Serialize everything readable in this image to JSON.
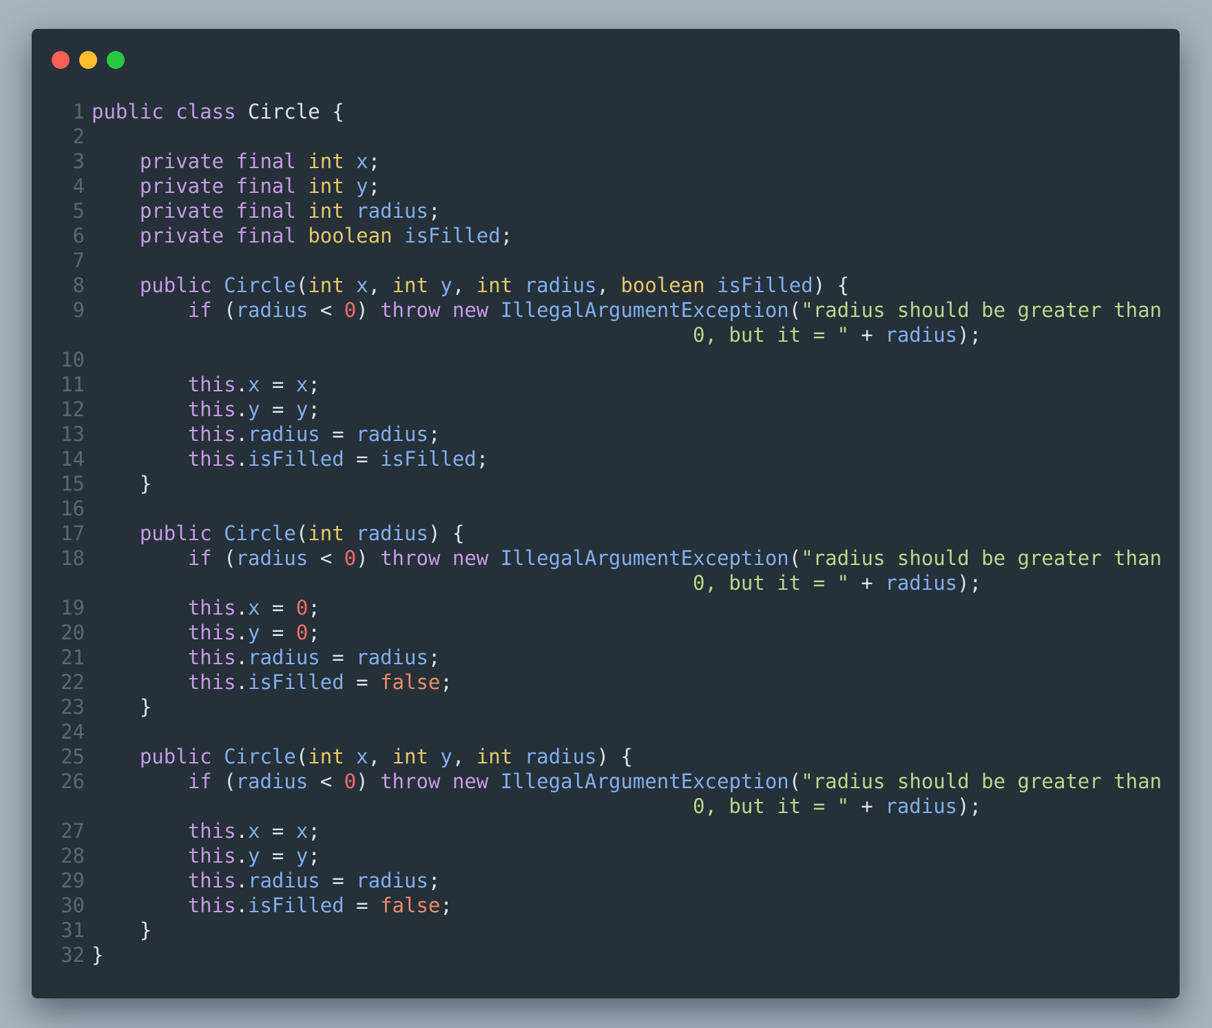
{
  "window": {
    "traffic_lights": [
      {
        "name": "close",
        "color": "#ff5f57"
      },
      {
        "name": "minimize",
        "color": "#febc2e"
      },
      {
        "name": "maximize",
        "color": "#28c840"
      }
    ]
  },
  "colors": {
    "background": "#a7b3bf",
    "editor": "#263038",
    "keyword": "#c79ae8",
    "type": "#e7c96b",
    "identifier": "#7fb0f0",
    "number": "#ef6f6b",
    "boolean": "#f08d66",
    "string": "#b9d98b",
    "plain": "#dfe4ea",
    "line_number": "#5b6771"
  },
  "code": {
    "language": "java",
    "lines": [
      {
        "n": "1",
        "rows": [
          [
            [
              "kw",
              "public"
            ],
            [
              "pl",
              " "
            ],
            [
              "kw",
              "class"
            ],
            [
              "pl",
              " Circle {"
            ]
          ]
        ]
      },
      {
        "n": "2",
        "rows": [
          []
        ]
      },
      {
        "n": "3",
        "rows": [
          [
            [
              "pl",
              "    "
            ],
            [
              "kw",
              "private"
            ],
            [
              "pl",
              " "
            ],
            [
              "kw",
              "final"
            ],
            [
              "pl",
              " "
            ],
            [
              "ty",
              "int"
            ],
            [
              "pl",
              " "
            ],
            [
              "id",
              "x"
            ],
            [
              "pl",
              ";"
            ]
          ]
        ]
      },
      {
        "n": "4",
        "rows": [
          [
            [
              "pl",
              "    "
            ],
            [
              "kw",
              "private"
            ],
            [
              "pl",
              " "
            ],
            [
              "kw",
              "final"
            ],
            [
              "pl",
              " "
            ],
            [
              "ty",
              "int"
            ],
            [
              "pl",
              " "
            ],
            [
              "id",
              "y"
            ],
            [
              "pl",
              ";"
            ]
          ]
        ]
      },
      {
        "n": "5",
        "rows": [
          [
            [
              "pl",
              "    "
            ],
            [
              "kw",
              "private"
            ],
            [
              "pl",
              " "
            ],
            [
              "kw",
              "final"
            ],
            [
              "pl",
              " "
            ],
            [
              "ty",
              "int"
            ],
            [
              "pl",
              " "
            ],
            [
              "id",
              "radius"
            ],
            [
              "pl",
              ";"
            ]
          ]
        ]
      },
      {
        "n": "6",
        "rows": [
          [
            [
              "pl",
              "    "
            ],
            [
              "kw",
              "private"
            ],
            [
              "pl",
              " "
            ],
            [
              "kw",
              "final"
            ],
            [
              "pl",
              " "
            ],
            [
              "ty",
              "boolean"
            ],
            [
              "pl",
              " "
            ],
            [
              "id",
              "isFilled"
            ],
            [
              "pl",
              ";"
            ]
          ]
        ]
      },
      {
        "n": "7",
        "rows": [
          []
        ]
      },
      {
        "n": "8",
        "rows": [
          [
            [
              "pl",
              "    "
            ],
            [
              "kw",
              "public"
            ],
            [
              "pl",
              " "
            ],
            [
              "id",
              "Circle"
            ],
            [
              "pl",
              "("
            ],
            [
              "ty",
              "int"
            ],
            [
              "pl",
              " "
            ],
            [
              "id",
              "x"
            ],
            [
              "pl",
              ", "
            ],
            [
              "ty",
              "int"
            ],
            [
              "pl",
              " "
            ],
            [
              "id",
              "y"
            ],
            [
              "pl",
              ", "
            ],
            [
              "ty",
              "int"
            ],
            [
              "pl",
              " "
            ],
            [
              "id",
              "radius"
            ],
            [
              "pl",
              ", "
            ],
            [
              "ty",
              "boolean"
            ],
            [
              "pl",
              " "
            ],
            [
              "id",
              "isFilled"
            ],
            [
              "pl",
              ") {"
            ]
          ]
        ]
      },
      {
        "n": "9",
        "rows": [
          [
            [
              "pl",
              "        "
            ],
            [
              "kw",
              "if"
            ],
            [
              "pl",
              " ("
            ],
            [
              "id",
              "radius"
            ],
            [
              "pl",
              " < "
            ],
            [
              "num",
              "0"
            ],
            [
              "pl",
              ") "
            ],
            [
              "kw",
              "throw"
            ],
            [
              "pl",
              " "
            ],
            [
              "kw",
              "new"
            ],
            [
              "pl",
              " "
            ],
            [
              "id",
              "IllegalArgumentException"
            ],
            [
              "pl",
              "("
            ],
            [
              "str",
              "\"radius should be greater than"
            ]
          ],
          [
            [
              "pl",
              "                                                  "
            ],
            [
              "str",
              "0, but it = \""
            ],
            [
              "pl",
              " + "
            ],
            [
              "id",
              "radius"
            ],
            [
              "pl",
              ");"
            ]
          ]
        ]
      },
      {
        "n": "10",
        "rows": [
          []
        ]
      },
      {
        "n": "11",
        "rows": [
          [
            [
              "pl",
              "        "
            ],
            [
              "kw",
              "this"
            ],
            [
              "pl",
              "."
            ],
            [
              "id",
              "x"
            ],
            [
              "pl",
              " = "
            ],
            [
              "id",
              "x"
            ],
            [
              "pl",
              ";"
            ]
          ]
        ]
      },
      {
        "n": "12",
        "rows": [
          [
            [
              "pl",
              "        "
            ],
            [
              "kw",
              "this"
            ],
            [
              "pl",
              "."
            ],
            [
              "id",
              "y"
            ],
            [
              "pl",
              " = "
            ],
            [
              "id",
              "y"
            ],
            [
              "pl",
              ";"
            ]
          ]
        ]
      },
      {
        "n": "13",
        "rows": [
          [
            [
              "pl",
              "        "
            ],
            [
              "kw",
              "this"
            ],
            [
              "pl",
              "."
            ],
            [
              "id",
              "radius"
            ],
            [
              "pl",
              " = "
            ],
            [
              "id",
              "radius"
            ],
            [
              "pl",
              ";"
            ]
          ]
        ]
      },
      {
        "n": "14",
        "rows": [
          [
            [
              "pl",
              "        "
            ],
            [
              "kw",
              "this"
            ],
            [
              "pl",
              "."
            ],
            [
              "id",
              "isFilled"
            ],
            [
              "pl",
              " = "
            ],
            [
              "id",
              "isFilled"
            ],
            [
              "pl",
              ";"
            ]
          ]
        ]
      },
      {
        "n": "15",
        "rows": [
          [
            [
              "pl",
              "    }"
            ]
          ]
        ]
      },
      {
        "n": "16",
        "rows": [
          []
        ]
      },
      {
        "n": "17",
        "rows": [
          [
            [
              "pl",
              "    "
            ],
            [
              "kw",
              "public"
            ],
            [
              "pl",
              " "
            ],
            [
              "id",
              "Circle"
            ],
            [
              "pl",
              "("
            ],
            [
              "ty",
              "int"
            ],
            [
              "pl",
              " "
            ],
            [
              "id",
              "radius"
            ],
            [
              "pl",
              ") {"
            ]
          ]
        ]
      },
      {
        "n": "18",
        "rows": [
          [
            [
              "pl",
              "        "
            ],
            [
              "kw",
              "if"
            ],
            [
              "pl",
              " ("
            ],
            [
              "id",
              "radius"
            ],
            [
              "pl",
              " < "
            ],
            [
              "num",
              "0"
            ],
            [
              "pl",
              ") "
            ],
            [
              "kw",
              "throw"
            ],
            [
              "pl",
              " "
            ],
            [
              "kw",
              "new"
            ],
            [
              "pl",
              " "
            ],
            [
              "id",
              "IllegalArgumentException"
            ],
            [
              "pl",
              "("
            ],
            [
              "str",
              "\"radius should be greater than"
            ]
          ],
          [
            [
              "pl",
              "                                                  "
            ],
            [
              "str",
              "0, but it = \""
            ],
            [
              "pl",
              " + "
            ],
            [
              "id",
              "radius"
            ],
            [
              "pl",
              ");"
            ]
          ]
        ]
      },
      {
        "n": "19",
        "rows": [
          [
            [
              "pl",
              "        "
            ],
            [
              "kw",
              "this"
            ],
            [
              "pl",
              "."
            ],
            [
              "id",
              "x"
            ],
            [
              "pl",
              " = "
            ],
            [
              "num",
              "0"
            ],
            [
              "pl",
              ";"
            ]
          ]
        ]
      },
      {
        "n": "20",
        "rows": [
          [
            [
              "pl",
              "        "
            ],
            [
              "kw",
              "this"
            ],
            [
              "pl",
              "."
            ],
            [
              "id",
              "y"
            ],
            [
              "pl",
              " = "
            ],
            [
              "num",
              "0"
            ],
            [
              "pl",
              ";"
            ]
          ]
        ]
      },
      {
        "n": "21",
        "rows": [
          [
            [
              "pl",
              "        "
            ],
            [
              "kw",
              "this"
            ],
            [
              "pl",
              "."
            ],
            [
              "id",
              "radius"
            ],
            [
              "pl",
              " = "
            ],
            [
              "id",
              "radius"
            ],
            [
              "pl",
              ";"
            ]
          ]
        ]
      },
      {
        "n": "22",
        "rows": [
          [
            [
              "pl",
              "        "
            ],
            [
              "kw",
              "this"
            ],
            [
              "pl",
              "."
            ],
            [
              "id",
              "isFilled"
            ],
            [
              "pl",
              " = "
            ],
            [
              "bool",
              "false"
            ],
            [
              "pl",
              ";"
            ]
          ]
        ]
      },
      {
        "n": "23",
        "rows": [
          [
            [
              "pl",
              "    }"
            ]
          ]
        ]
      },
      {
        "n": "24",
        "rows": [
          []
        ]
      },
      {
        "n": "25",
        "rows": [
          [
            [
              "pl",
              "    "
            ],
            [
              "kw",
              "public"
            ],
            [
              "pl",
              " "
            ],
            [
              "id",
              "Circle"
            ],
            [
              "pl",
              "("
            ],
            [
              "ty",
              "int"
            ],
            [
              "pl",
              " "
            ],
            [
              "id",
              "x"
            ],
            [
              "pl",
              ", "
            ],
            [
              "ty",
              "int"
            ],
            [
              "pl",
              " "
            ],
            [
              "id",
              "y"
            ],
            [
              "pl",
              ", "
            ],
            [
              "ty",
              "int"
            ],
            [
              "pl",
              " "
            ],
            [
              "id",
              "radius"
            ],
            [
              "pl",
              ") {"
            ]
          ]
        ]
      },
      {
        "n": "26",
        "rows": [
          [
            [
              "pl",
              "        "
            ],
            [
              "kw",
              "if"
            ],
            [
              "pl",
              " ("
            ],
            [
              "id",
              "radius"
            ],
            [
              "pl",
              " < "
            ],
            [
              "num",
              "0"
            ],
            [
              "pl",
              ") "
            ],
            [
              "kw",
              "throw"
            ],
            [
              "pl",
              " "
            ],
            [
              "kw",
              "new"
            ],
            [
              "pl",
              " "
            ],
            [
              "id",
              "IllegalArgumentException"
            ],
            [
              "pl",
              "("
            ],
            [
              "str",
              "\"radius should be greater than"
            ]
          ],
          [
            [
              "pl",
              "                                                  "
            ],
            [
              "str",
              "0, but it = \""
            ],
            [
              "pl",
              " + "
            ],
            [
              "id",
              "radius"
            ],
            [
              "pl",
              ");"
            ]
          ]
        ]
      },
      {
        "n": "27",
        "rows": [
          [
            [
              "pl",
              "        "
            ],
            [
              "kw",
              "this"
            ],
            [
              "pl",
              "."
            ],
            [
              "id",
              "x"
            ],
            [
              "pl",
              " = "
            ],
            [
              "id",
              "x"
            ],
            [
              "pl",
              ";"
            ]
          ]
        ]
      },
      {
        "n": "28",
        "rows": [
          [
            [
              "pl",
              "        "
            ],
            [
              "kw",
              "this"
            ],
            [
              "pl",
              "."
            ],
            [
              "id",
              "y"
            ],
            [
              "pl",
              " = "
            ],
            [
              "id",
              "y"
            ],
            [
              "pl",
              ";"
            ]
          ]
        ]
      },
      {
        "n": "29",
        "rows": [
          [
            [
              "pl",
              "        "
            ],
            [
              "kw",
              "this"
            ],
            [
              "pl",
              "."
            ],
            [
              "id",
              "radius"
            ],
            [
              "pl",
              " = "
            ],
            [
              "id",
              "radius"
            ],
            [
              "pl",
              ";"
            ]
          ]
        ]
      },
      {
        "n": "30",
        "rows": [
          [
            [
              "pl",
              "        "
            ],
            [
              "kw",
              "this"
            ],
            [
              "pl",
              "."
            ],
            [
              "id",
              "isFilled"
            ],
            [
              "pl",
              " = "
            ],
            [
              "bool",
              "false"
            ],
            [
              "pl",
              ";"
            ]
          ]
        ]
      },
      {
        "n": "31",
        "rows": [
          [
            [
              "pl",
              "    }"
            ]
          ]
        ]
      },
      {
        "n": "32",
        "rows": [
          [
            [
              "pl",
              "}"
            ]
          ]
        ]
      }
    ]
  }
}
